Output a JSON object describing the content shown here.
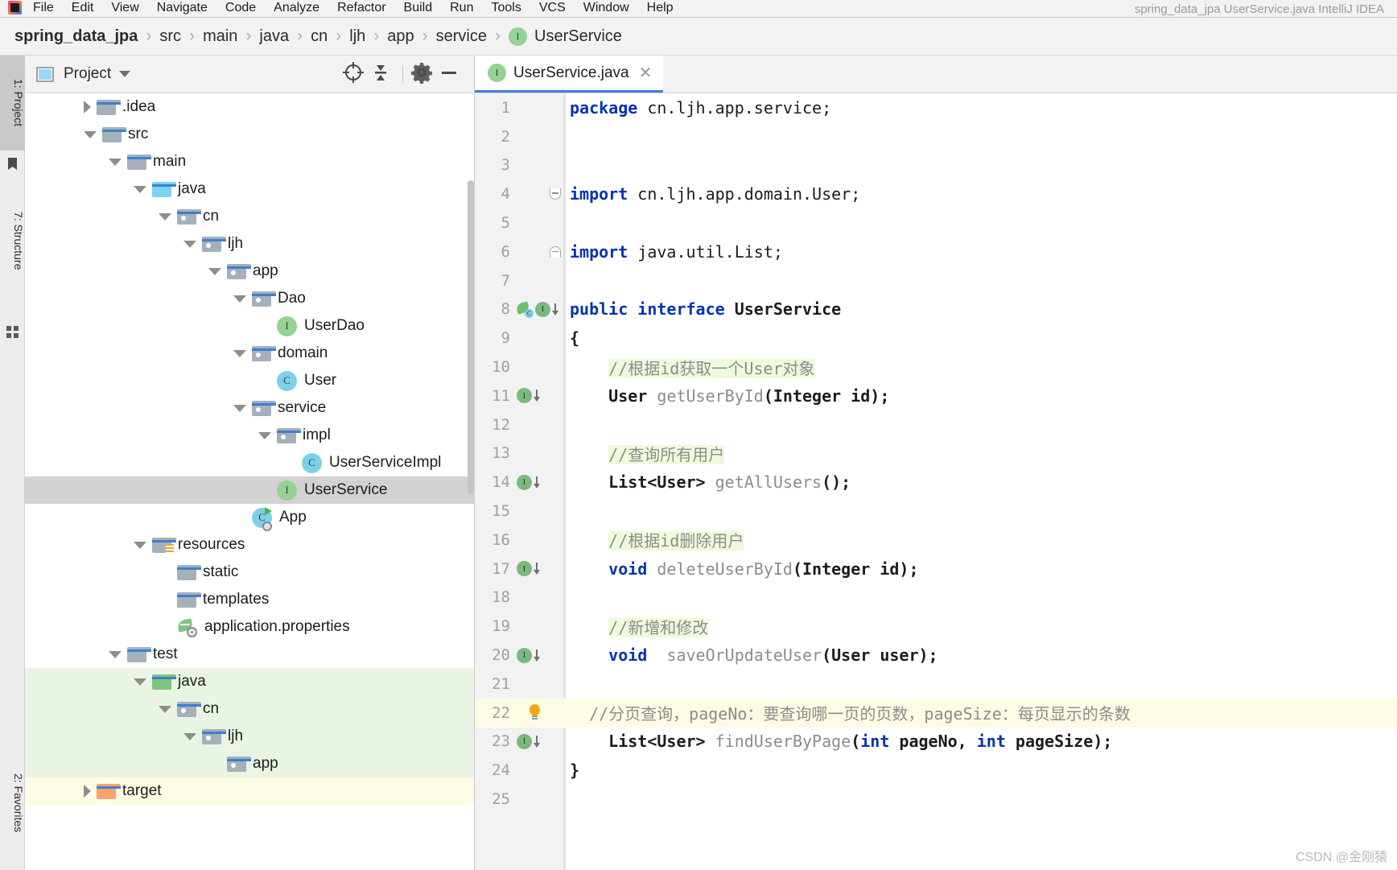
{
  "menubar": {
    "items": [
      "File",
      "Edit",
      "View",
      "Navigate",
      "Code",
      "Analyze",
      "Refactor",
      "Build",
      "Run",
      "Tools",
      "VCS",
      "Window",
      "Help"
    ],
    "window_title": "spring_data_jpa  UserService.java  IntelliJ IDEA",
    "logo_name": "intellij-idea-logo"
  },
  "breadcrumb": {
    "items": [
      {
        "label": "spring_data_jpa",
        "kind": "project"
      },
      {
        "label": "src",
        "kind": "folder"
      },
      {
        "label": "main",
        "kind": "folder"
      },
      {
        "label": "java",
        "kind": "folder"
      },
      {
        "label": "cn",
        "kind": "package"
      },
      {
        "label": "ljh",
        "kind": "package"
      },
      {
        "label": "app",
        "kind": "package"
      },
      {
        "label": "service",
        "kind": "package"
      },
      {
        "label": "UserService",
        "kind": "interface",
        "badge": "I"
      }
    ],
    "separator": "›"
  },
  "left_strip": {
    "tabs": [
      {
        "label": "1: Project",
        "active": true
      },
      {
        "label": "7: Structure",
        "active": false
      },
      {
        "label": "2: Favorites",
        "active": false
      }
    ],
    "icons": [
      "bookmark-icon",
      "modules-icon"
    ]
  },
  "project_panel": {
    "title": "Project",
    "icon": "project-view-icon",
    "dropdown_icon": "chevron-down-icon",
    "toolbar": [
      {
        "name": "locate-icon",
        "glyph": "⊕"
      },
      {
        "name": "collapse-all-icon",
        "glyph": "⤓"
      },
      {
        "name": "settings-gear-icon",
        "glyph": "⚙"
      },
      {
        "name": "hide-panel-icon",
        "glyph": "−"
      }
    ],
    "tree": [
      {
        "label": ".idea",
        "indent": 1,
        "twisty": "closed",
        "icon": "folder",
        "state": ""
      },
      {
        "label": "src",
        "indent": 1,
        "twisty": "open",
        "icon": "folder",
        "state": ""
      },
      {
        "label": "main",
        "indent": 2,
        "twisty": "open",
        "icon": "folder",
        "state": ""
      },
      {
        "label": "java",
        "indent": 3,
        "twisty": "open",
        "icon": "folder-blue",
        "state": ""
      },
      {
        "label": "cn",
        "indent": 4,
        "twisty": "open",
        "icon": "package",
        "state": ""
      },
      {
        "label": "ljh",
        "indent": 5,
        "twisty": "open",
        "icon": "package",
        "state": ""
      },
      {
        "label": "app",
        "indent": 6,
        "twisty": "open",
        "icon": "package",
        "state": ""
      },
      {
        "label": "Dao",
        "indent": 7,
        "twisty": "open",
        "icon": "package",
        "state": ""
      },
      {
        "label": "UserDao",
        "indent": 8,
        "twisty": "none",
        "icon": "interface",
        "state": ""
      },
      {
        "label": "domain",
        "indent": 7,
        "twisty": "open",
        "icon": "package",
        "state": ""
      },
      {
        "label": "User",
        "indent": 8,
        "twisty": "none",
        "icon": "class",
        "state": ""
      },
      {
        "label": "service",
        "indent": 7,
        "twisty": "open",
        "icon": "package",
        "state": ""
      },
      {
        "label": "impl",
        "indent": 8,
        "twisty": "open",
        "icon": "package",
        "state": ""
      },
      {
        "label": "UserServiceImpl",
        "indent": 9,
        "twisty": "none",
        "icon": "class",
        "state": ""
      },
      {
        "label": "UserService",
        "indent": 8,
        "twisty": "none",
        "icon": "interface",
        "state": "selected"
      },
      {
        "label": "App",
        "indent": 7,
        "twisty": "none",
        "icon": "class-run",
        "state": ""
      },
      {
        "label": "resources",
        "indent": 3,
        "twisty": "open",
        "icon": "folder-res",
        "state": ""
      },
      {
        "label": "static",
        "indent": 4,
        "twisty": "none",
        "icon": "folder",
        "state": ""
      },
      {
        "label": "templates",
        "indent": 4,
        "twisty": "none",
        "icon": "folder",
        "state": ""
      },
      {
        "label": "application.properties",
        "indent": 4,
        "twisty": "none",
        "icon": "spring-file",
        "state": ""
      },
      {
        "label": "test",
        "indent": 2,
        "twisty": "open",
        "icon": "folder",
        "state": ""
      },
      {
        "label": "java",
        "indent": 3,
        "twisty": "open",
        "icon": "folder-green",
        "state": "test"
      },
      {
        "label": "cn",
        "indent": 4,
        "twisty": "open",
        "icon": "package",
        "state": "test"
      },
      {
        "label": "ljh",
        "indent": 5,
        "twisty": "open",
        "icon": "package",
        "state": "test"
      },
      {
        "label": "app",
        "indent": 6,
        "twisty": "none",
        "icon": "package",
        "state": "test"
      },
      {
        "label": "target",
        "indent": 1,
        "twisty": "closed",
        "icon": "folder-orange",
        "state": "target"
      }
    ]
  },
  "editor": {
    "tab": {
      "label": "UserService.java",
      "badge": "I",
      "close_icon": "close-icon"
    },
    "lines": [
      {
        "n": "1",
        "gutter": "",
        "fold": "",
        "caret": false,
        "tokens": [
          {
            "t": "package ",
            "c": "kw"
          },
          {
            "t": "cn.ljh.app.service;",
            "c": "pkgn"
          }
        ]
      },
      {
        "n": "2",
        "gutter": "",
        "fold": "",
        "caret": false,
        "tokens": []
      },
      {
        "n": "3",
        "gutter": "",
        "fold": "",
        "caret": false,
        "tokens": []
      },
      {
        "n": "4",
        "gutter": "",
        "fold": "top",
        "caret": false,
        "tokens": [
          {
            "t": "import ",
            "c": "kw"
          },
          {
            "t": "cn.ljh.app.domain.User;",
            "c": "pkgn"
          }
        ]
      },
      {
        "n": "5",
        "gutter": "",
        "fold": "",
        "caret": false,
        "tokens": []
      },
      {
        "n": "6",
        "gutter": "",
        "fold": "bot",
        "caret": false,
        "tokens": [
          {
            "t": "import ",
            "c": "kw"
          },
          {
            "t": "java.util.List;",
            "c": "pkgn"
          }
        ]
      },
      {
        "n": "7",
        "gutter": "",
        "fold": "",
        "caret": false,
        "tokens": []
      },
      {
        "n": "8",
        "gutter": "bean",
        "fold": "",
        "caret": false,
        "tokens": [
          {
            "t": "public ",
            "c": "kw"
          },
          {
            "t": "interface ",
            "c": "kw"
          },
          {
            "t": "UserService",
            "c": "ifacename"
          }
        ]
      },
      {
        "n": "9",
        "gutter": "",
        "fold": "",
        "caret": false,
        "tokens": [
          {
            "t": "{",
            "c": "punc"
          }
        ]
      },
      {
        "n": "10",
        "gutter": "",
        "fold": "",
        "caret": false,
        "tokens": [
          {
            "t": "    ",
            "c": "punc"
          },
          {
            "t": "//根据id获取一个User对象",
            "c": "cmt"
          }
        ]
      },
      {
        "n": "11",
        "gutter": "impl",
        "fold": "",
        "caret": false,
        "tokens": [
          {
            "t": "    ",
            "c": "punc"
          },
          {
            "t": "User",
            "c": "type"
          },
          {
            "t": " ",
            "c": "punc"
          },
          {
            "t": "getUserById",
            "c": "decl"
          },
          {
            "t": "(",
            "c": "punc"
          },
          {
            "t": "Integer",
            "c": "type"
          },
          {
            "t": " id);",
            "c": "punc"
          }
        ]
      },
      {
        "n": "12",
        "gutter": "",
        "fold": "",
        "caret": false,
        "tokens": []
      },
      {
        "n": "13",
        "gutter": "",
        "fold": "",
        "caret": false,
        "tokens": [
          {
            "t": "    ",
            "c": "punc"
          },
          {
            "t": "//查询所有用户",
            "c": "cmt"
          }
        ]
      },
      {
        "n": "14",
        "gutter": "impl",
        "fold": "",
        "caret": false,
        "tokens": [
          {
            "t": "    ",
            "c": "punc"
          },
          {
            "t": "List<User>",
            "c": "type"
          },
          {
            "t": " ",
            "c": "punc"
          },
          {
            "t": "getAllUsers",
            "c": "decl"
          },
          {
            "t": "();",
            "c": "punc"
          }
        ]
      },
      {
        "n": "15",
        "gutter": "",
        "fold": "",
        "caret": false,
        "tokens": []
      },
      {
        "n": "16",
        "gutter": "",
        "fold": "",
        "caret": false,
        "tokens": [
          {
            "t": "    ",
            "c": "punc"
          },
          {
            "t": "//根据id删除用户",
            "c": "cmt"
          }
        ]
      },
      {
        "n": "17",
        "gutter": "impl",
        "fold": "",
        "caret": false,
        "tokens": [
          {
            "t": "    ",
            "c": "punc"
          },
          {
            "t": "void",
            "c": "kw"
          },
          {
            "t": " ",
            "c": "punc"
          },
          {
            "t": "deleteUserById",
            "c": "decl"
          },
          {
            "t": "(",
            "c": "punc"
          },
          {
            "t": "Integer",
            "c": "type"
          },
          {
            "t": " id);",
            "c": "punc"
          }
        ]
      },
      {
        "n": "18",
        "gutter": "",
        "fold": "",
        "caret": false,
        "tokens": []
      },
      {
        "n": "19",
        "gutter": "",
        "fold": "",
        "caret": false,
        "tokens": [
          {
            "t": "    ",
            "c": "punc"
          },
          {
            "t": "//新增和修改",
            "c": "cmt"
          }
        ]
      },
      {
        "n": "20",
        "gutter": "impl",
        "fold": "",
        "caret": false,
        "tokens": [
          {
            "t": "    ",
            "c": "punc"
          },
          {
            "t": "void",
            "c": "kw"
          },
          {
            "t": "  ",
            "c": "punc"
          },
          {
            "t": "saveOrUpdateUser",
            "c": "decl"
          },
          {
            "t": "(",
            "c": "punc"
          },
          {
            "t": "User",
            "c": "type"
          },
          {
            "t": " user);",
            "c": "punc"
          }
        ]
      },
      {
        "n": "21",
        "gutter": "",
        "fold": "",
        "caret": false,
        "tokens": []
      },
      {
        "n": "22",
        "gutter": "bulb",
        "fold": "",
        "caret": true,
        "tokens": [
          {
            "t": "  ",
            "c": "punc"
          },
          {
            "t": "//分页查询，pageNo：要查询哪一页的页数，pageSize：每页显示的条数",
            "c": "cmt-plain"
          }
        ]
      },
      {
        "n": "23",
        "gutter": "impl",
        "fold": "",
        "caret": false,
        "tokens": [
          {
            "t": "    ",
            "c": "punc"
          },
          {
            "t": "List<User>",
            "c": "type"
          },
          {
            "t": " ",
            "c": "punc"
          },
          {
            "t": "findUserByPage",
            "c": "decl"
          },
          {
            "t": "(",
            "c": "punc"
          },
          {
            "t": "int",
            "c": "kw"
          },
          {
            "t": " pageNo, ",
            "c": "punc"
          },
          {
            "t": "int",
            "c": "kw"
          },
          {
            "t": " pageSize);",
            "c": "punc"
          }
        ]
      },
      {
        "n": "24",
        "gutter": "",
        "fold": "",
        "caret": false,
        "tokens": [
          {
            "t": "}",
            "c": "punc"
          }
        ]
      },
      {
        "n": "25",
        "gutter": "",
        "fold": "",
        "caret": false,
        "tokens": []
      }
    ]
  },
  "watermark": {
    "text": "CSDN @金刚猿"
  },
  "colors": {
    "accent_blue": "#3c7fd4",
    "keyword_blue": "#0033b3",
    "comment_gray": "#8c8c8c",
    "comment_bg": "#eefadc",
    "interface_green": "#96d196",
    "class_blue": "#7fcfe8",
    "selected_row": "#d2d2d2",
    "test_source_bg": "#e9f5e2",
    "target_bg": "#fdfbe4",
    "panel_bg": "#f2f2f2"
  }
}
